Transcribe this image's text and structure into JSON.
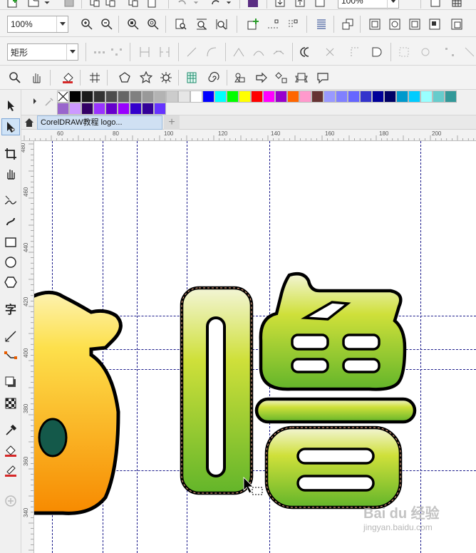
{
  "toolbar_standard": {
    "zoom_value": "100%"
  },
  "property_bar": {
    "zoom_value": "100%",
    "shape_select": "矩形"
  },
  "tab": {
    "title": "CorelDRAW教程 logo...",
    "add_label": "+"
  },
  "ruler": {
    "h_ticks": [
      "60",
      "80",
      "100",
      "120",
      "140",
      "160",
      "180",
      "200"
    ],
    "v_ticks": [
      "480",
      "460",
      "440",
      "420",
      "400",
      "380",
      "360",
      "340"
    ]
  },
  "palette": {
    "row1": [
      "#ffffff",
      "#000000",
      "#1a1a1a",
      "#333333",
      "#4d4d4d",
      "#666666",
      "#808080",
      "#999999",
      "#b3b3b3",
      "#cccccc",
      "#e6e6e6",
      "#ffffff",
      "#0000ff",
      "#00ffff",
      "#00ff00",
      "#ffff00",
      "#ff0000",
      "#ff00ff",
      "#9900cc",
      "#ff6600",
      "#ff99cc",
      "#663333",
      "#9999ff",
      "#8080ff",
      "#6666ff",
      "#3333cc",
      "#000099",
      "#000066",
      "#0099cc",
      "#00ccff",
      "#99ffff",
      "#66cccc",
      "#339999"
    ],
    "row2": [
      "#9966cc",
      "#cc99ff",
      "#330066",
      "#9933ff",
      "#6600cc",
      "#9900ff",
      "#3300cc",
      "#330099",
      "#6633ff"
    ]
  },
  "canvas": {
    "text_fill_top": "#f3f5d6",
    "text_fill_bottom": "#63b52a",
    "left_fill_top": "#fde04c",
    "left_fill_bottom": "#f78a00",
    "dot_color": "#14594a"
  },
  "watermark": {
    "line1": "Bai du 经验",
    "line2": "jingyan.baidu.com"
  }
}
